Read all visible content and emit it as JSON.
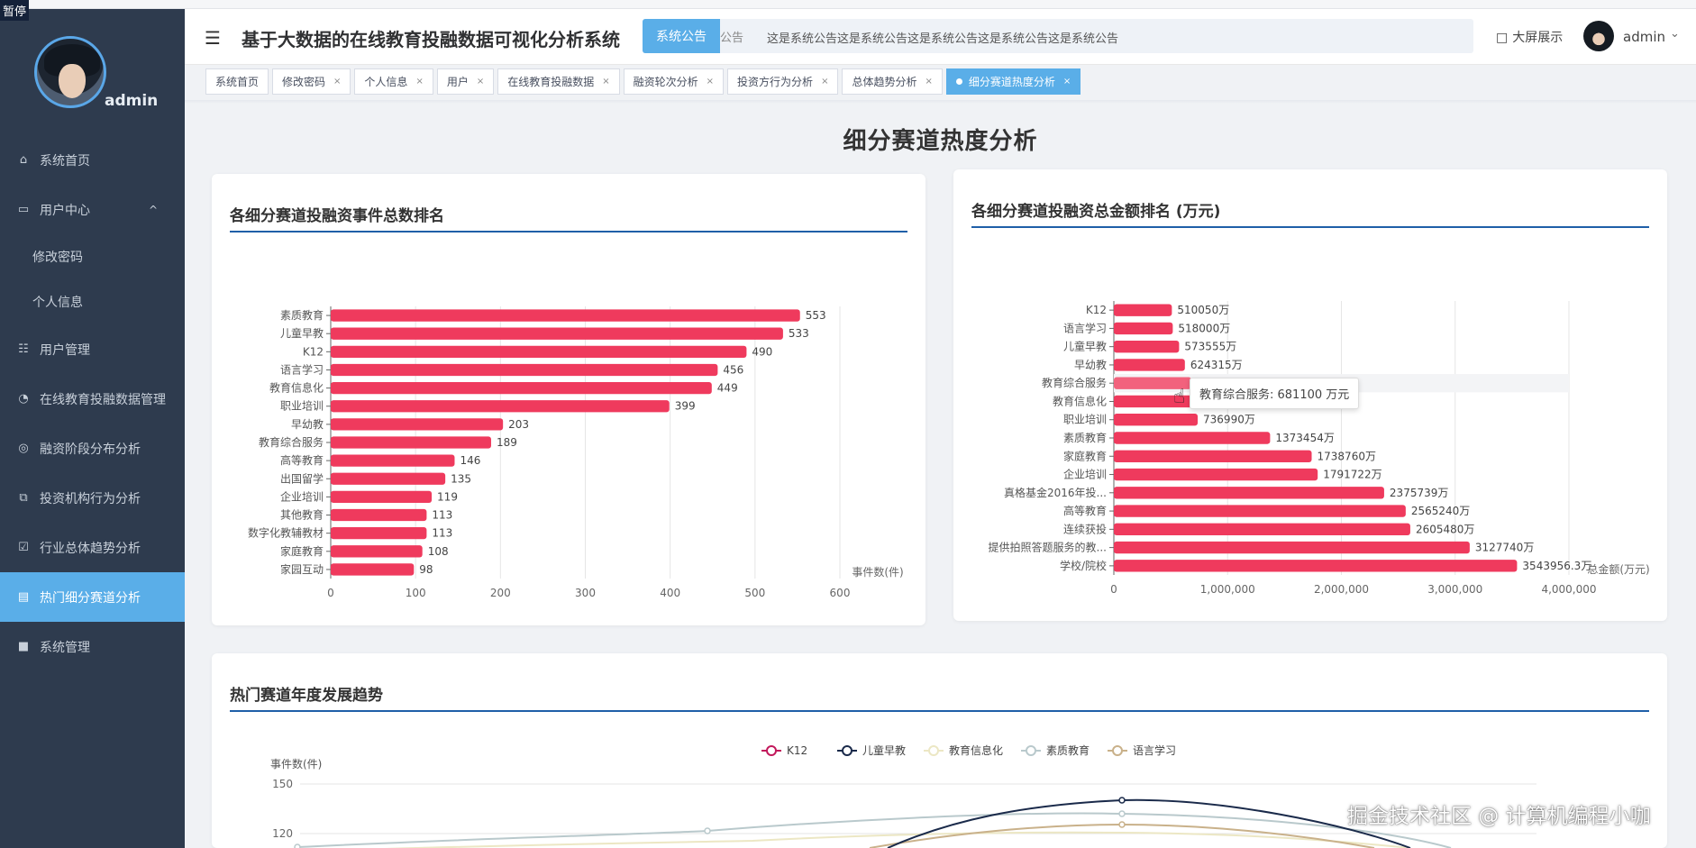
{
  "sidebar": {
    "pause_label": "暂停",
    "username": "admin",
    "items": [
      {
        "label": "系统首页",
        "icon": "home-icon"
      },
      {
        "label": "用户中心",
        "icon": "user-center-icon",
        "caret": "^"
      },
      {
        "label": "修改密码",
        "sub": true
      },
      {
        "label": "个人信息",
        "sub": true
      },
      {
        "label": "用户管理",
        "icon": "grid-icon"
      },
      {
        "label": "在线教育投融数据管理",
        "icon": "gauge-icon"
      },
      {
        "label": "融资阶段分布分析",
        "icon": "target-icon"
      },
      {
        "label": "投资机构行为分析",
        "icon": "copy-icon"
      },
      {
        "label": "行业总体趋势分析",
        "icon": "clipboard-icon"
      },
      {
        "label": "热门细分赛道分析",
        "icon": "briefcase-icon",
        "active": true
      },
      {
        "label": "系统管理",
        "icon": "chat-icon"
      }
    ]
  },
  "header": {
    "title": "基于大数据的在线教育投融数据可视化分析系统",
    "notice_label": "系统公告",
    "notice_ghost": "公告",
    "notice_text": "这是系统公告这是系统公告这是系统公告这是系统公告这是系统公告",
    "bigscreen": "大屏展示",
    "username": "admin"
  },
  "tabs": [
    {
      "label": "系统首页",
      "closable": false
    },
    {
      "label": "修改密码",
      "closable": true
    },
    {
      "label": "个人信息",
      "closable": true
    },
    {
      "label": "用户",
      "closable": true
    },
    {
      "label": "在线教育投融数据",
      "closable": true
    },
    {
      "label": "融资轮次分析",
      "closable": true
    },
    {
      "label": "投资方行为分析",
      "closable": true
    },
    {
      "label": "总体趋势分析",
      "closable": true
    },
    {
      "label": "细分赛道热度分析",
      "closable": true,
      "active": true
    }
  ],
  "page_title": "细分赛道热度分析",
  "colors": {
    "bar": "#ef3a5d",
    "accent": "#5aaee8",
    "sidebar": "#2e3b4e",
    "rule": "#1f5fa8"
  },
  "tooltip": {
    "text": "教育综合服务: 681100 万元"
  },
  "watermark": "掘金技术社区 @ 计算机编程小咖",
  "chart_data": [
    {
      "type": "bar",
      "orientation": "horizontal",
      "title": "各细分赛道投融资事件总数排名",
      "xlabel": "事件数(件)",
      "xlim": [
        0,
        600
      ],
      "xticks": [
        0,
        100,
        200,
        300,
        400,
        500,
        600
      ],
      "categories": [
        "素质教育",
        "儿童早教",
        "K12",
        "语言学习",
        "教育信息化",
        "职业培训",
        "早幼教",
        "教育综合服务",
        "高等教育",
        "出国留学",
        "企业培训",
        "其他教育",
        "数字化教辅教材",
        "家庭教育",
        "家园互动"
      ],
      "values": [
        553,
        533,
        490,
        456,
        449,
        399,
        203,
        189,
        146,
        135,
        119,
        113,
        113,
        108,
        98
      ],
      "value_labels": [
        "553",
        "533",
        "490",
        "456",
        "449",
        "399",
        "203",
        "189",
        "146",
        "135",
        "119",
        "113",
        "113",
        "108",
        "98"
      ]
    },
    {
      "type": "bar",
      "orientation": "horizontal",
      "title": "各细分赛道投融资总金额排名 (万元)",
      "xlabel": "总金额(万元)",
      "xlim": [
        0,
        4000000
      ],
      "xticks": [
        0,
        1000000,
        2000000,
        3000000,
        4000000
      ],
      "xtick_labels": [
        "0",
        "1,000,000",
        "2,000,000",
        "3,000,000",
        "4,000,000"
      ],
      "categories": [
        "K12",
        "语言学习",
        "儿童早教",
        "早幼教",
        "教育综合服务",
        "教育信息化",
        "职业培训",
        "素质教育",
        "家庭教育",
        "企业培训",
        "真格基金2016年投...",
        "高等教育",
        "连续获投",
        "提供拍照答题服务的教...",
        "学校/院校"
      ],
      "values": [
        510050,
        518000,
        573555,
        624315,
        681100,
        690000,
        736990,
        1373454,
        1738760,
        1791722,
        2375739,
        2565240,
        2605480,
        3127740,
        3543956.3
      ],
      "value_labels": [
        "510050万",
        "518000万",
        "573555万",
        "624315万",
        "",
        "",
        "736990万",
        "1373454万",
        "1738760万",
        "1791722万",
        "2375739万",
        "2565240万",
        "2605480万",
        "3127740万",
        "3543956.3万"
      ],
      "highlight_index": 4
    },
    {
      "type": "line",
      "title": "热门赛道年度发展趋势",
      "ylabel": "事件数(件)",
      "visible_yticks": [
        150,
        120
      ],
      "series": [
        {
          "name": "K12",
          "color": "#c2185b"
        },
        {
          "name": "儿童早教",
          "color": "#1a2a4a"
        },
        {
          "name": "教育信息化",
          "color": "#ece7c4"
        },
        {
          "name": "素质教育",
          "color": "#b9c9cc"
        },
        {
          "name": "语言学习",
          "color": "#c9b18a"
        }
      ]
    }
  ]
}
